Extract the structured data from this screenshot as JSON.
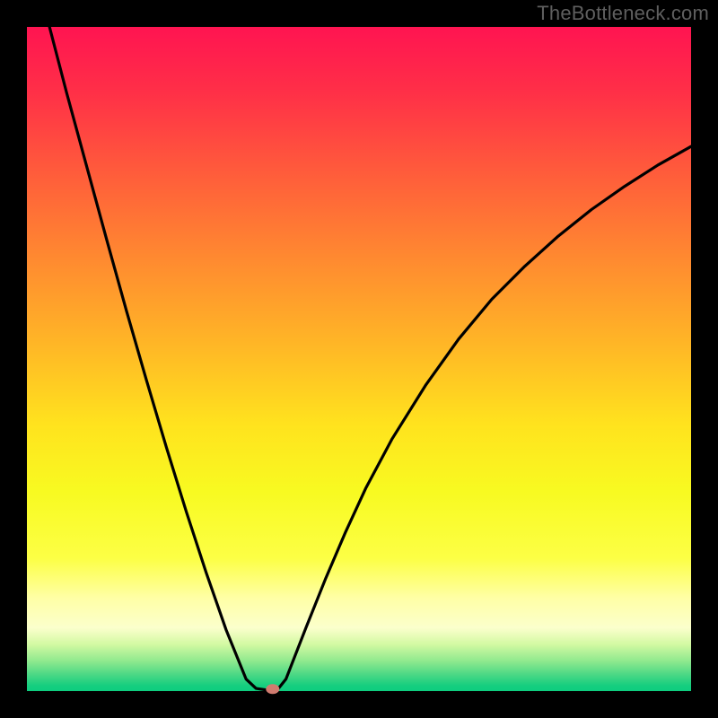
{
  "watermark": "TheBottleneck.com",
  "chart_data": {
    "type": "line",
    "title": "",
    "xlabel": "",
    "ylabel": "",
    "xlim": [
      0,
      100
    ],
    "ylim": [
      0,
      100
    ],
    "grid": false,
    "series": [
      {
        "name": "bottleneck-curve",
        "points": [
          {
            "x": 3.4,
            "y": 100.0
          },
          {
            "x": 6.0,
            "y": 90.0
          },
          {
            "x": 9.0,
            "y": 79.0
          },
          {
            "x": 12.0,
            "y": 68.0
          },
          {
            "x": 15.0,
            "y": 57.2
          },
          {
            "x": 18.0,
            "y": 46.8
          },
          {
            "x": 21.0,
            "y": 36.7
          },
          {
            "x": 24.0,
            "y": 27.0
          },
          {
            "x": 27.0,
            "y": 17.8
          },
          {
            "x": 30.0,
            "y": 9.2
          },
          {
            "x": 33.0,
            "y": 1.8
          },
          {
            "x": 34.5,
            "y": 0.4
          },
          {
            "x": 36.5,
            "y": 0.1
          },
          {
            "x": 37.8,
            "y": 0.3
          },
          {
            "x": 39.0,
            "y": 1.8
          },
          {
            "x": 42.0,
            "y": 9.5
          },
          {
            "x": 45.0,
            "y": 17.0
          },
          {
            "x": 48.0,
            "y": 24.0
          },
          {
            "x": 51.0,
            "y": 30.5
          },
          {
            "x": 55.0,
            "y": 38.0
          },
          {
            "x": 60.0,
            "y": 46.0
          },
          {
            "x": 65.0,
            "y": 53.0
          },
          {
            "x": 70.0,
            "y": 59.0
          },
          {
            "x": 75.0,
            "y": 64.0
          },
          {
            "x": 80.0,
            "y": 68.5
          },
          {
            "x": 85.0,
            "y": 72.5
          },
          {
            "x": 90.0,
            "y": 76.0
          },
          {
            "x": 95.0,
            "y": 79.2
          },
          {
            "x": 100.0,
            "y": 82.0
          }
        ]
      }
    ],
    "optimum_marker": {
      "x": 37.0,
      "y": 0.3
    },
    "gradient_stops": [
      {
        "offset": 0.0,
        "color": "#ff1451"
      },
      {
        "offset": 0.1,
        "color": "#ff3047"
      },
      {
        "offset": 0.22,
        "color": "#ff5c3b"
      },
      {
        "offset": 0.35,
        "color": "#ff8a30"
      },
      {
        "offset": 0.48,
        "color": "#ffb726"
      },
      {
        "offset": 0.6,
        "color": "#ffe31e"
      },
      {
        "offset": 0.7,
        "color": "#f8fa21"
      },
      {
        "offset": 0.8,
        "color": "#fcff45"
      },
      {
        "offset": 0.86,
        "color": "#ffffa6"
      },
      {
        "offset": 0.905,
        "color": "#fbffcc"
      },
      {
        "offset": 0.93,
        "color": "#d2f9a2"
      },
      {
        "offset": 0.955,
        "color": "#8fe98e"
      },
      {
        "offset": 0.975,
        "color": "#4cd885"
      },
      {
        "offset": 0.992,
        "color": "#15ce7f"
      },
      {
        "offset": 1.0,
        "color": "#0ecd7f"
      }
    ]
  },
  "plot_geometry": {
    "outer_width": 800,
    "outer_height": 800,
    "inner_left": 30,
    "inner_top": 30,
    "inner_width": 740,
    "inner_height": 740
  }
}
